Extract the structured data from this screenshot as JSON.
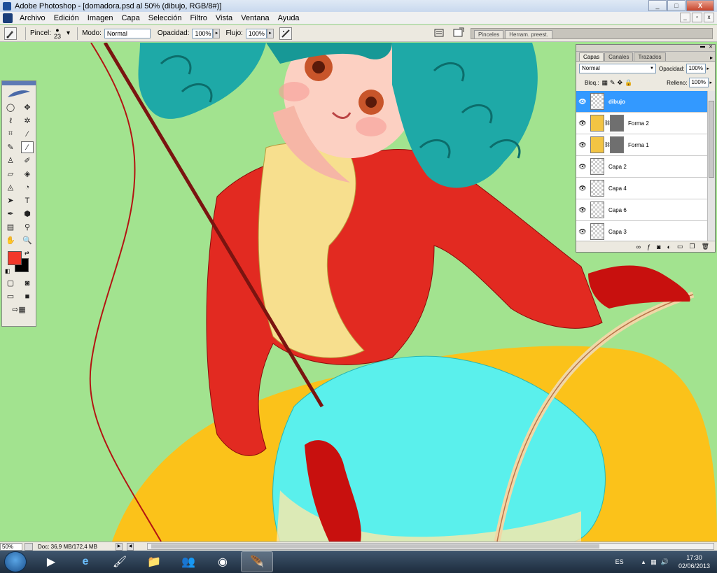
{
  "window": {
    "title": "Adobe Photoshop - [domadora.psd al 50% (dibujo, RGB/8#)]",
    "buttons": [
      "_",
      "□",
      "X"
    ]
  },
  "menu": {
    "items": [
      "Archivo",
      "Edición",
      "Imagen",
      "Capa",
      "Selección",
      "Filtro",
      "Vista",
      "Ventana",
      "Ayuda"
    ]
  },
  "options": {
    "brush_label": "Pincel:",
    "brush_size": "23",
    "mode_label": "Modo:",
    "mode_value": "Normal",
    "opacity_label": "Opacidad:",
    "opacity_value": "100%",
    "flow_label": "Flujo:",
    "flow_value": "100%",
    "well_tabs": [
      "Pinceles",
      "Herram. preest."
    ]
  },
  "toolbox": {
    "foreground_color": "#f2382a",
    "background_color": "#000000"
  },
  "layers_panel": {
    "tabs": [
      "Capas",
      "Canales",
      "Trazados"
    ],
    "blend_mode": "Normal",
    "opacity_label": "Opacidad:",
    "opacity_value": "100%",
    "lock_label": "Bloq.:",
    "fill_label": "Relleno:",
    "fill_value": "100%",
    "layers": [
      {
        "name": "dibujo",
        "selected": true
      },
      {
        "name": "Forma 2",
        "selected": false
      },
      {
        "name": "Forma 1",
        "selected": false
      },
      {
        "name": "Capa 2",
        "selected": false
      },
      {
        "name": "Capa 4",
        "selected": false
      },
      {
        "name": "Capa 6",
        "selected": false
      },
      {
        "name": "Capa 3",
        "selected": false
      }
    ]
  },
  "status": {
    "zoom": "50%",
    "doc": "Doc: 36,9 MB/172,4 MB"
  },
  "taskbar": {
    "lang": "ES",
    "time": "17:30",
    "date": "02/06/2013"
  }
}
